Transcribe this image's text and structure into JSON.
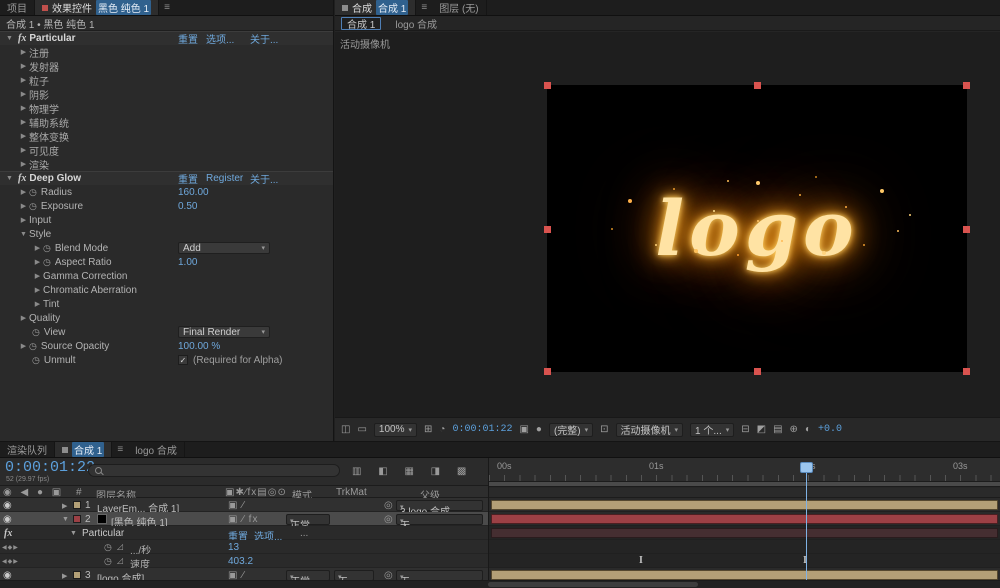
{
  "colors": {
    "accent_blue": "#6fa8dc",
    "selection_blue": "#30618e",
    "bar_tan": "#b3a077",
    "bar_red": "#9c4045",
    "handle_red": "#d9534f",
    "glow_orange": "#ff9e2a"
  },
  "icons": {
    "menu": "≡",
    "twirl_open": "▼",
    "twirl_closed": "▶",
    "stopwatch": "◷",
    "dropdown_arrow": "▾",
    "eye": "◉",
    "pickwhip": "◎",
    "fx_badge": "fx",
    "check": "✓",
    "kf_nav": "◀◆▶",
    "keyframe_ibeam": "I",
    "av_header": "◉ ◀ ● ▣",
    "switch_header": "▣✱∕fx▤◎⊙",
    "mini_toggles": "▥ ◧ ▦ ◨ ▩",
    "tb_view1": "◫",
    "tb_view2": "▭",
    "tb_grid": "⊞",
    "tb_mask": "◔",
    "tb_snapshot": "▣",
    "tb_channels": "●",
    "tb_roi": "⊡",
    "tb_pixel": "⊟",
    "tb_fast": "◩",
    "tb_timeline": "▤",
    "tb_flow": "⊕",
    "tb_exposure": "◐",
    "graph_toggle": "◿"
  },
  "effects_panel": {
    "tab_project": "项目",
    "tab_effects_label": "效果控件",
    "tab_effects_target": "黑色 纯色 1",
    "breadcrumb": "合成 1 • 黑色 纯色 1",
    "particular": {
      "name": "Particular",
      "link_reset": "重置",
      "link_options": "选项...",
      "link_about": "关于...",
      "groups": [
        "注册",
        "发射器",
        "粒子",
        "阴影",
        "物理学",
        "辅助系统",
        "整体变换",
        "可见度",
        "渲染"
      ]
    },
    "deepglow": {
      "name": "Deep Glow",
      "link_reset": "重置",
      "link_register": "Register",
      "link_about": "关于...",
      "radius_label": "Radius",
      "radius_value": "160.00",
      "exposure_label": "Exposure",
      "exposure_value": "0.50",
      "input_label": "Input",
      "style_label": "Style",
      "blend_label": "Blend Mode",
      "blend_value": "Add",
      "aspect_label": "Aspect Ratio",
      "aspect_value": "1.00",
      "gamma_label": "Gamma Correction",
      "chromatic_label": "Chromatic Aberration",
      "tint_label": "Tint",
      "quality_label": "Quality",
      "view_label": "View",
      "view_value": "Final Render",
      "opacity_label": "Source Opacity",
      "opacity_value": "100.00 %",
      "unmult_label": "Unmult",
      "unmult_note": "(Required for Alpha)"
    }
  },
  "comp_panel": {
    "tab_comp_label": "合成",
    "tab_comp_target": "合成 1",
    "tab_layer": "图层 (无)",
    "viewer_tab_active": "合成 1",
    "viewer_tab_other": "logo 合成",
    "camera_label": "活动摄像机",
    "logo_text": "logo",
    "toolbar": {
      "zoom": "100%",
      "timecode": "0:00:01:22",
      "resolution": "(完整)",
      "camera": "活动摄像机",
      "views": "1 个...",
      "exposure": "+0.0"
    }
  },
  "timeline": {
    "tab_queue": "渲染队列",
    "tab_active": "合成 1",
    "tab_other": "logo 合成",
    "timecode": "0:00:01:22",
    "frame_info": "52 (29.97 fps)",
    "headers": {
      "hash": "#",
      "name": "图层名称",
      "mode": "模式",
      "trkmat": "TrkMat",
      "parent": "父级"
    },
    "rows": [
      {
        "num": "1",
        "name": "LayerEm... 合成 1]",
        "switches": "▣ ∕",
        "mode": "",
        "trkmat": "",
        "parent": "3.logo 合成"
      },
      {
        "num": "2",
        "name": "[黑色 纯色 1]",
        "switches": "▣ ∕ fx",
        "mode": "正常",
        "trkmat": "",
        "parent": "无"
      },
      {
        "num": "3",
        "name": "[logo 合成]",
        "switches": "▣ ∕",
        "mode": "正常",
        "trkmat": "无",
        "parent": "无"
      }
    ],
    "effect": {
      "name": "Particular",
      "reset": "重置",
      "options": "选项...",
      "more": "..."
    },
    "props": [
      {
        "label": ".../秒",
        "value": "13"
      },
      {
        "label": "速度",
        "value": "403.2"
      }
    ],
    "ruler_labels": [
      "00s",
      "01s",
      "02s",
      "03s"
    ]
  }
}
